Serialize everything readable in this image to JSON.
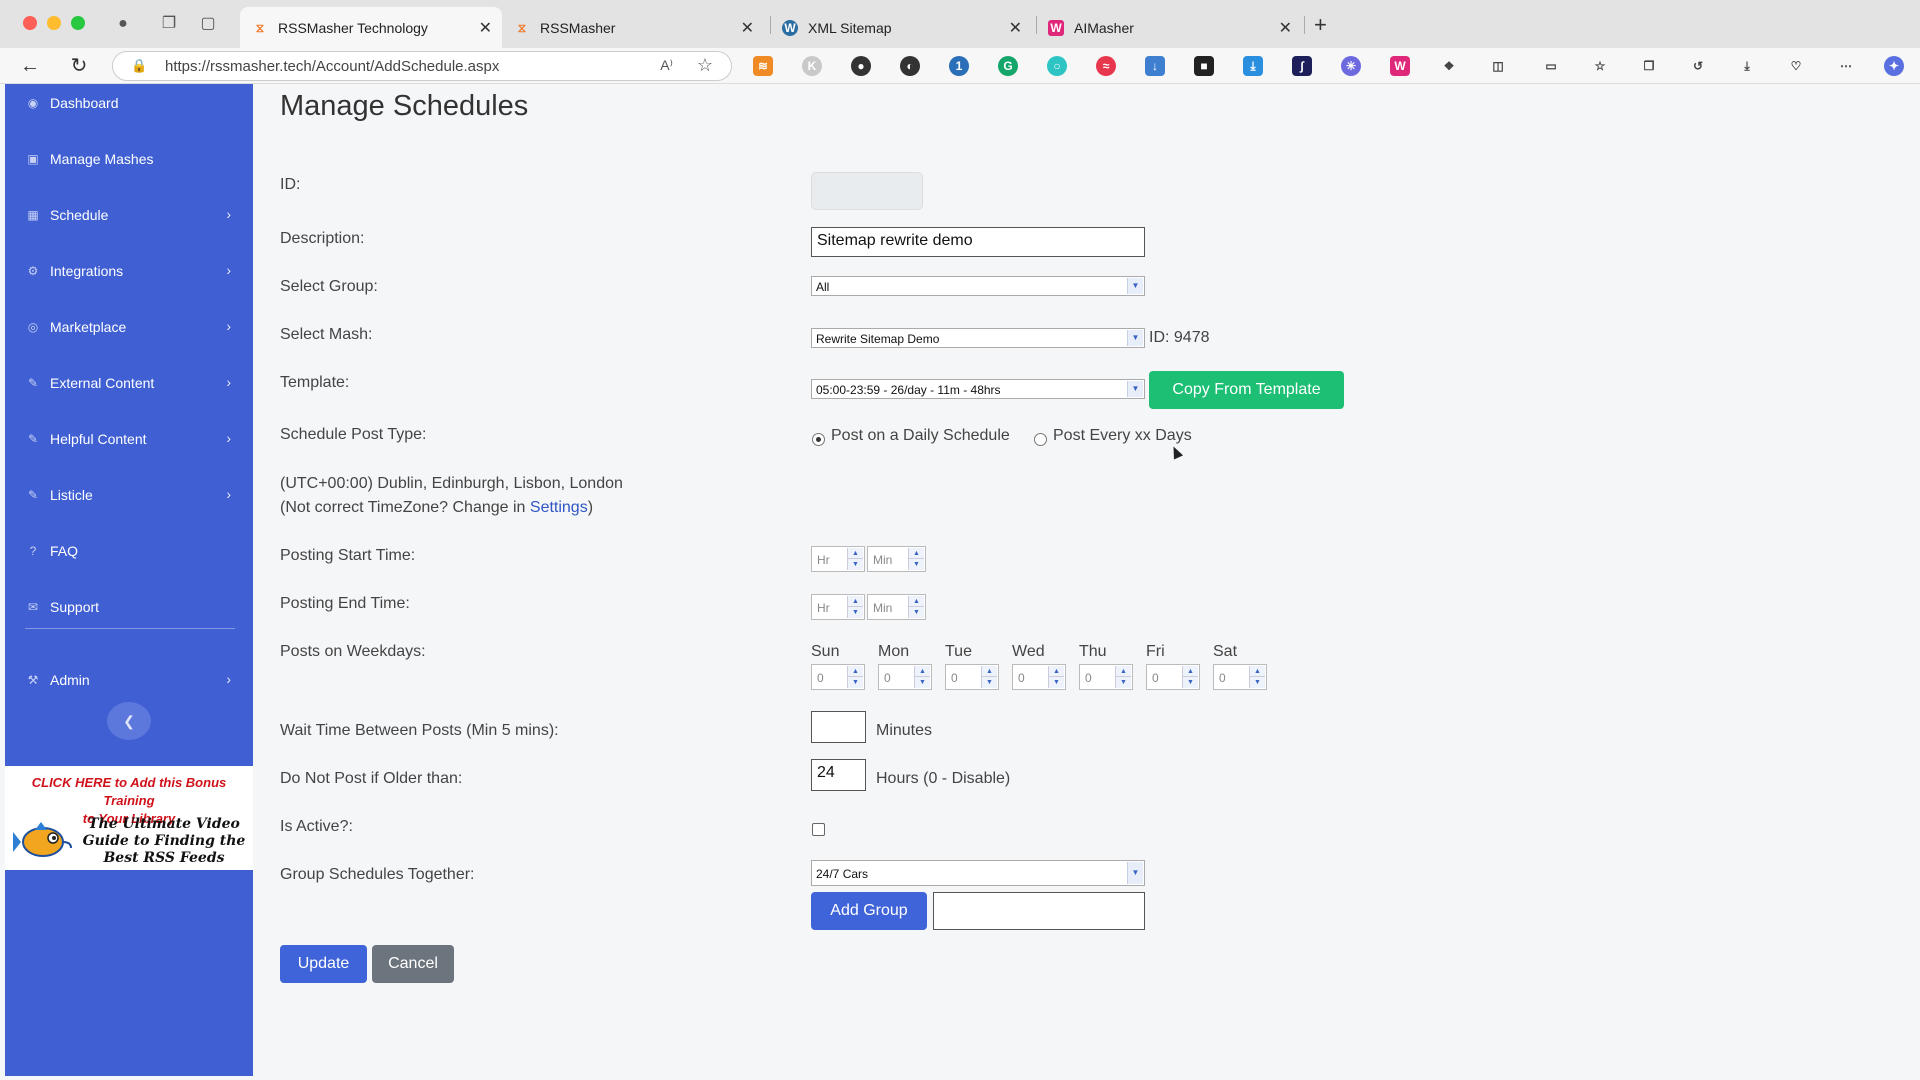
{
  "browser": {
    "tabs": [
      {
        "label": "RSSMasher Technology",
        "favicon": "rssmasher-icon"
      },
      {
        "label": "RSSMasher",
        "favicon": "rssmasher-icon"
      },
      {
        "label": "XML Sitemap",
        "favicon": "wordpress-icon"
      },
      {
        "label": "AIMasher",
        "favicon": "aimasher-icon"
      }
    ],
    "url": "https://rssmasher.tech/Account/AddSchedule.aspx",
    "read_aloud": "A⁾"
  },
  "sidebar": {
    "items": [
      {
        "label": "Dashboard",
        "icon": "dashboard-icon",
        "glyph": "◉",
        "chevron": false
      },
      {
        "label": "Manage Mashes",
        "icon": "manage-mashes-icon",
        "glyph": "▣",
        "chevron": false
      },
      {
        "label": "Schedule",
        "icon": "calendar-icon",
        "glyph": "▦",
        "chevron": true
      },
      {
        "label": "Integrations",
        "icon": "gear-icon",
        "glyph": "⚙",
        "chevron": true
      },
      {
        "label": "Marketplace",
        "icon": "globe-icon",
        "glyph": "◎",
        "chevron": true
      },
      {
        "label": "External Content",
        "icon": "edit-icon",
        "glyph": "✎",
        "chevron": true
      },
      {
        "label": "Helpful Content",
        "icon": "edit-icon",
        "glyph": "✎",
        "chevron": true
      },
      {
        "label": "Listicle",
        "icon": "edit-icon",
        "glyph": "✎",
        "chevron": true
      },
      {
        "label": "FAQ",
        "icon": "question-icon",
        "glyph": "?",
        "chevron": false
      },
      {
        "label": "Support",
        "icon": "envelope-icon",
        "glyph": "✉",
        "chevron": false
      },
      {
        "label": "Admin",
        "icon": "wrench-icon",
        "glyph": "⚒",
        "chevron": true
      }
    ],
    "promo": {
      "top_line1": "CLICK HERE to Add this Bonus Training",
      "top_line2": "to Your Library",
      "bottom": "The Ultimate Video Guide to Finding the Best RSS Feeds"
    }
  },
  "form": {
    "title": "Manage Schedules",
    "id_label": "ID:",
    "id_value": "",
    "description_label": "Description:",
    "description_value": "Sitemap rewrite demo",
    "group_label": "Select Group:",
    "group_value": "All",
    "mash_label": "Select Mash:",
    "mash_value": "Rewrite Sitemap Demo",
    "mash_id": "ID: 9478",
    "template_label": "Template:",
    "template_value": "05:00-23:59 - 26/day - 11m - 48hrs",
    "copy_template_button": "Copy From Template",
    "post_type_label": "Schedule Post Type:",
    "post_type_daily": "Post on a Daily Schedule",
    "post_type_every": "Post Every xx Days",
    "timezone_line1": "(UTC+00:00) Dublin, Edinburgh, Lisbon, London",
    "timezone_prefix": "(Not correct TimeZone? Change in ",
    "timezone_link": "Settings",
    "timezone_suffix": ")",
    "start_time_label": "Posting Start Time:",
    "end_time_label": "Posting End Time:",
    "hr_placeholder": "Hr",
    "min_placeholder": "Min",
    "weekdays_label": "Posts on Weekdays:",
    "weekdays": [
      {
        "day": "Sun",
        "value": "0"
      },
      {
        "day": "Mon",
        "value": "0"
      },
      {
        "day": "Tue",
        "value": "0"
      },
      {
        "day": "Wed",
        "value": "0"
      },
      {
        "day": "Thu",
        "value": "0"
      },
      {
        "day": "Fri",
        "value": "0"
      },
      {
        "day": "Sat",
        "value": "0"
      }
    ],
    "wait_label": "Wait Time Between Posts (Min 5 mins):",
    "wait_value": "",
    "wait_unit": "Minutes",
    "older_label": "Do Not Post if Older than:",
    "older_value": "24",
    "older_unit": "Hours (0 - Disable)",
    "active_label": "Is Active?:",
    "group_together_label": "Group Schedules Together:",
    "group_together_value": "24/7 Cars",
    "add_group_button": "Add Group",
    "new_group_value": "",
    "update_button": "Update",
    "cancel_button": "Cancel"
  }
}
